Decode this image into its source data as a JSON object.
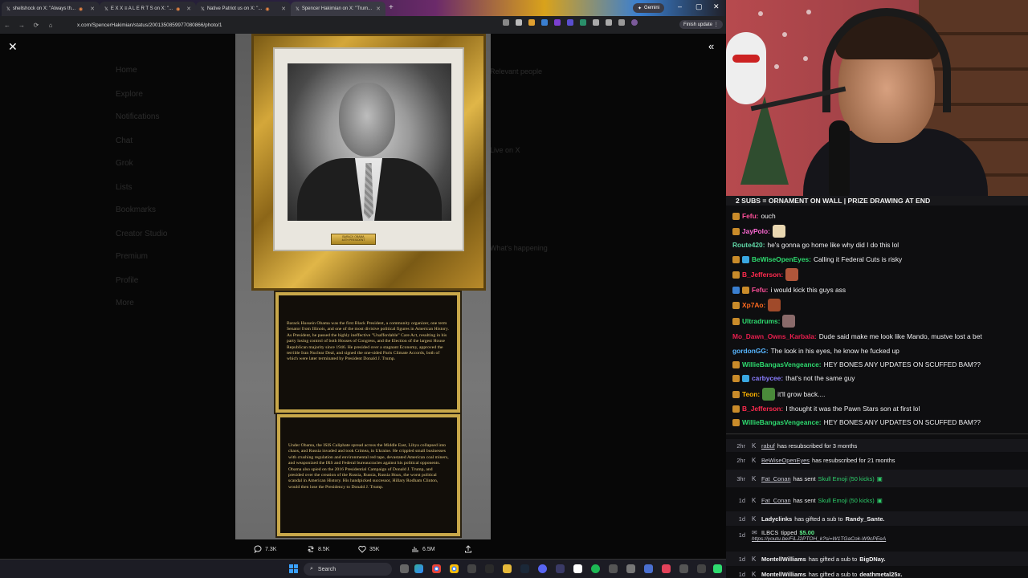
{
  "browser": {
    "tabs": [
      {
        "title": "shellshock on X: \"Always th...",
        "active": false
      },
      {
        "title": "E X X ≡ A L E R T S on X: \"...",
        "active": false
      },
      {
        "title": "Native Patriot us on X: \"...",
        "active": false
      },
      {
        "title": "Spencer Hakimian on X: \"Trum...",
        "active": true
      }
    ],
    "gemini_label": "Gemini",
    "url": "x.com/SpencerHakimian/status/2001350859977080866/photo/1",
    "finish_update_label": "Finish update"
  },
  "viewer": {
    "background_nav": [
      "Home",
      "Explore",
      "Notifications",
      "Chat",
      "Grok",
      "Lists",
      "Bookmarks",
      "Creator Studio",
      "Premium",
      "Profile",
      "More"
    ],
    "background_right": [
      "Relevant people",
      "Live on X",
      "What's happening"
    ],
    "nameplate": [
      "BARACK OBAMA",
      "44TH PRESIDENT"
    ],
    "plaque1_text": "Barack Hussein Obama was the first Black President, a community organizer, one term Senator from Illinois, and one of the most divisive political figures in American History. As President, he passed the highly ineffective \"Unaffordable\" Care Act, resulting in his party losing control of both Houses of Congress, and the Election of the largest House Republican majority since 1946. He presided over a stagnant Economy, approved the terrible Iran Nuclear Deal, and signed the one-sided Paris Climate Accords, both of which were later terminated by President Donald J. Trump.",
    "plaque2_text": "Under Obama, the ISIS Caliphate spread across the Middle East, Libya collapsed into chaos, and Russia invaded and took Crimea, in Ukraine. He crippled small businesses with crushing regulation and environmental red tape, devastated American coal miners, and weaponized the IRS and Federal bureaucracies against his political opponents. Obama also spied on the 2016 Presidential Campaign of Donald J. Trump, and presided over the creation of the Russia, Russia, Russia Hoax, the worst political scandal in American History. His handpicked successor, Hillary Rodham Clinton, would then lose the Presidency to Donald J. Trump.",
    "replies": "7.3K",
    "reposts": "8.5K",
    "likes": "35K",
    "views": "6.5M"
  },
  "taskbar": {
    "search_label": "Search"
  },
  "stream": {
    "banner": "2 SUBS = ORNAMENT ON WALL | PRIZE DRAWING AT END",
    "chat": [
      {
        "user": "Fefu:",
        "text": "ouch",
        "color": "#ff4f9a"
      },
      {
        "user": "JayPolo:",
        "text": "",
        "color": "#ff6ad5"
      },
      {
        "user": "Route420:",
        "text": "he's gonna go home like why did I do this lol",
        "color": "#5fd6a6"
      },
      {
        "user": "BeWiseOpenEyes:",
        "text": "Calling it Federal Cuts is risky",
        "color": "#2edb6f"
      },
      {
        "user": "B_Jefferson:",
        "text": "",
        "color": "#ff2a4e"
      },
      {
        "user": "Fefu:",
        "text": "i would kick this guys ass",
        "color": "#ff4f9a"
      },
      {
        "user": "Xp7Ao:",
        "text": "",
        "color": "#ff6a1f"
      },
      {
        "user": "Ultradrums:",
        "text": "",
        "color": "#2edb6f"
      },
      {
        "user": "Mo_Dawn_Owns_Karbala:",
        "text": "Dude said make me look like Mando, mustve lost a bet",
        "color": "#e81e4e"
      },
      {
        "user": "gordonGG:",
        "text": "The look in his eyes, he know he fucked up",
        "color": "#58b6ff"
      },
      {
        "user": "WillieBangasVengeance:",
        "text": "HEY BONES ANY UPDATES ON SCUFFED BAM??",
        "color": "#2edb6f"
      },
      {
        "user": "carbycee:",
        "text": "that's not the same guy",
        "color": "#8a7dff"
      },
      {
        "user": "Teon:",
        "text": "it'll grow back....",
        "color": "#ffb400"
      },
      {
        "user": "B_Jefferson:",
        "text": "I thought it was the Pawn Stars son at first lol",
        "color": "#ff2a4e"
      },
      {
        "user": "WillieBangasVengeance:",
        "text": "HEY BONES ANY UPDATES ON SCUFFED BAM??",
        "color": "#2edb6f"
      }
    ],
    "events": [
      {
        "time": "2hr",
        "user": "rabuf",
        "text": "has resubscribed for 3 months"
      },
      {
        "time": "2hr",
        "user": "BeWiseOpenEyes",
        "text": "has resubscribed for 21 months"
      },
      {
        "time": "3hr",
        "user": "Fat_Conan",
        "text": "has sent",
        "gift": "Skull Emoji (50 kicks)"
      },
      {
        "time": "1d",
        "user": "Fat_Conan",
        "text": "has sent",
        "gift": "Skull Emoji (50 kicks)"
      },
      {
        "time": "1d",
        "user": "Ladyclinks",
        "text": "has gifted a sub to",
        "target": "Randy_Sante."
      },
      {
        "time": "1d",
        "user": "ILBCS",
        "text": "tipped",
        "amount": "$5.00",
        "link": "https://youtu.be/FiLJ2PTOH_k?si=W1TGaCok-W9cPEeA"
      },
      {
        "time": "1d",
        "user": "MontellWilliams",
        "text": "has gifted a sub to",
        "target": "BigDNay."
      },
      {
        "time": "1d",
        "user": "MontellWilliams",
        "text": "has gifted a sub to",
        "target": "deathmetal25x."
      }
    ]
  }
}
